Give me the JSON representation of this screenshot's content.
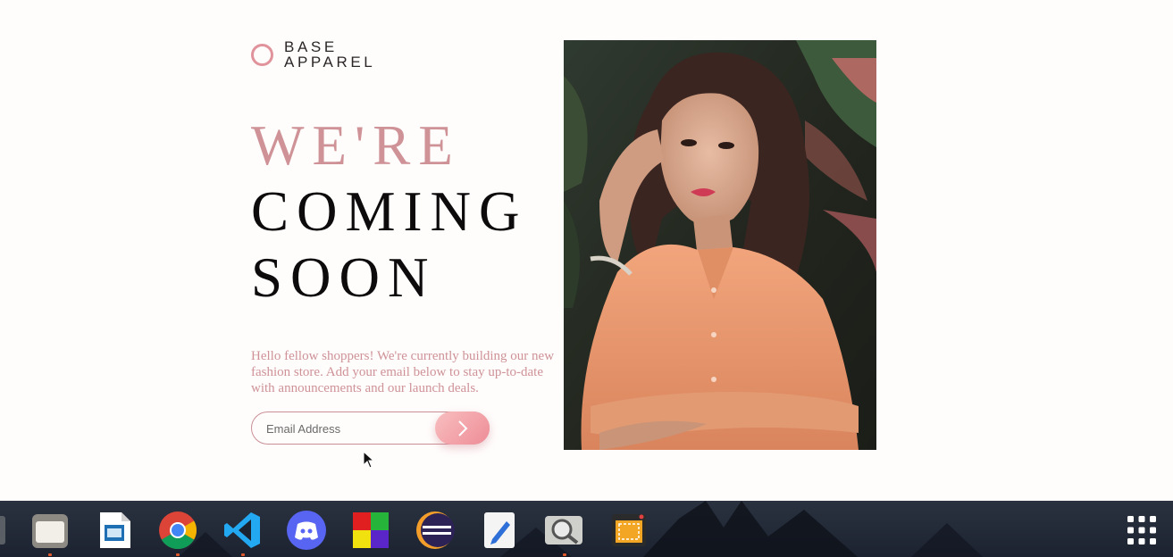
{
  "brand": {
    "line1": "BASE",
    "line2": "APPAREL"
  },
  "headline": {
    "line1": "WE'RE",
    "line2": "COMING",
    "line3": "SOON"
  },
  "description": "Hello fellow shoppers! We're currently building our new fashion store. Add your email below to stay up-to-date with announcements and our launch deals.",
  "form": {
    "email_placeholder": "Email Address",
    "submit_icon": "chevron-right-icon"
  },
  "hero_image": {
    "subject": "woman-in-orange-shirt"
  },
  "colors": {
    "accent": "#ce9297",
    "dark": "#0d0b0b",
    "background": "#fffdfc",
    "button": "#ee8c96"
  },
  "taskbar": {
    "apps": [
      "files-icon",
      "libreoffice-draw-icon",
      "chrome-icon",
      "vscode-icon",
      "discord-icon",
      "app-grid-colorful-icon",
      "eclipse-icon",
      "text-editor-icon",
      "image-viewer-icon",
      "screenshot-tool-icon"
    ],
    "show_apps": "app-launcher-icon"
  }
}
